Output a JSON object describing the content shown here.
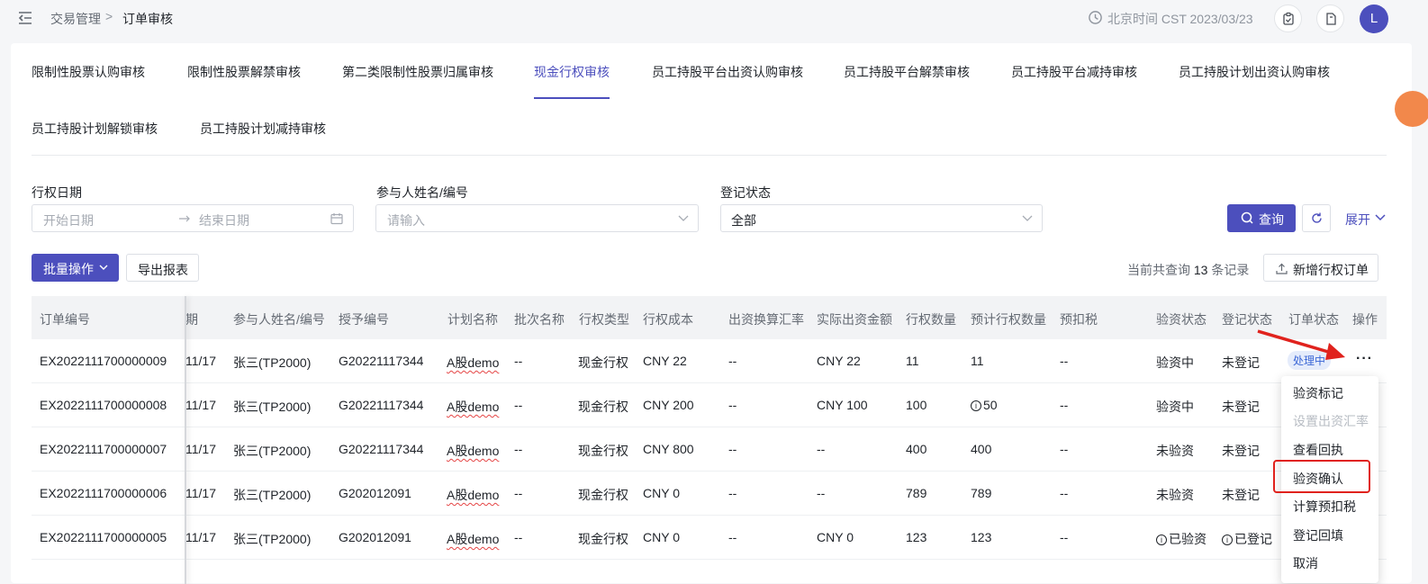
{
  "breadcrumb": {
    "parent": "交易管理",
    "separator": ">",
    "current": "订单审核"
  },
  "header": {
    "time_text": "北京时间 CST 2023/03/23",
    "avatar_letter": "L"
  },
  "tabs": [
    "限制性股票认购审核",
    "限制性股票解禁审核",
    "第二类限制性股票归属审核",
    "现金行权审核",
    "员工持股平台出资认购审核",
    "员工持股平台解禁审核",
    "员工持股平台减持审核",
    "员工持股计划出资认购审核",
    "员工持股计划解锁审核",
    "员工持股计划减持审核"
  ],
  "active_tab": "现金行权审核",
  "filters": {
    "date_label": "行权日期",
    "date_start_placeholder": "开始日期",
    "date_end_placeholder": "结束日期",
    "participant_label": "参与人姓名/编号",
    "participant_placeholder": "请输入",
    "register_label": "登记状态",
    "register_value": "全部",
    "query_button": "查询",
    "expand_link": "展开"
  },
  "toolbar": {
    "batch_button": "批量操作",
    "export_button": "导出报表",
    "count_prefix": "当前共查询",
    "count": "13",
    "count_suffix": "条记录",
    "add_button": "新增行权订单"
  },
  "table": {
    "columns": [
      "订单编号",
      "期",
      "参与人姓名/编号",
      "授予编号",
      "计划名称",
      "批次名称",
      "行权类型",
      "行权成本",
      "出资换算汇率",
      "实际出资金额",
      "行权数量",
      "预计行权数量",
      "预扣税",
      "验资状态",
      "登记状态",
      "订单状态",
      "操作"
    ],
    "rows": [
      {
        "order": "EX2022111700000009",
        "date": "11/17",
        "participant": "张三(TP2000)",
        "grant": "G20221117344",
        "plan": "A股demo",
        "batch": "--",
        "type": "现金行权",
        "cost": "CNY 22",
        "rate": "--",
        "amount": "CNY 22",
        "qty": "11",
        "est_qty": "11",
        "est_qty_info": false,
        "tax": "--",
        "verify": "验资中",
        "verify_info": false,
        "register": "未登记",
        "register_info": false,
        "order_status": "处理中",
        "action": "···"
      },
      {
        "order": "EX2022111700000008",
        "date": "11/17",
        "participant": "张三(TP2000)",
        "grant": "G20221117344",
        "plan": "A股demo",
        "batch": "--",
        "type": "现金行权",
        "cost": "CNY 200",
        "rate": "--",
        "amount": "CNY 100",
        "qty": "100",
        "est_qty": "50",
        "est_qty_info": true,
        "tax": "--",
        "verify": "验资中",
        "verify_info": false,
        "register": "未登记",
        "register_info": false,
        "order_status": "",
        "action": ""
      },
      {
        "order": "EX2022111700000007",
        "date": "11/17",
        "participant": "张三(TP2000)",
        "grant": "G20221117344",
        "plan": "A股demo",
        "batch": "--",
        "type": "现金行权",
        "cost": "CNY 800",
        "rate": "--",
        "amount": "--",
        "qty": "400",
        "est_qty": "400",
        "est_qty_info": false,
        "tax": "--",
        "verify": "未验资",
        "verify_info": false,
        "register": "未登记",
        "register_info": false,
        "order_status": "",
        "action": ""
      },
      {
        "order": "EX2022111700000006",
        "date": "11/17",
        "participant": "张三(TP2000)",
        "grant": "G202012091",
        "plan": "A股demo",
        "batch": "--",
        "type": "现金行权",
        "cost": "CNY 0",
        "rate": "--",
        "amount": "--",
        "qty": "789",
        "est_qty": "789",
        "est_qty_info": false,
        "tax": "--",
        "verify": "未验资",
        "verify_info": false,
        "register": "未登记",
        "register_info": false,
        "order_status": "",
        "action": ""
      },
      {
        "order": "EX2022111700000005",
        "date": "11/17",
        "participant": "张三(TP2000)",
        "grant": "G202012091",
        "plan": "A股demo",
        "batch": "--",
        "type": "现金行权",
        "cost": "CNY 0",
        "rate": "--",
        "amount": "CNY 0",
        "qty": "123",
        "est_qty": "123",
        "est_qty_info": false,
        "tax": "--",
        "verify": "已验资",
        "verify_info": true,
        "register": "已登记",
        "register_info": true,
        "order_status": "",
        "action": ""
      }
    ]
  },
  "action_menu": {
    "items": [
      {
        "label": "验资标记",
        "disabled": false
      },
      {
        "label": "设置出资汇率",
        "disabled": true
      },
      {
        "label": "查看回执",
        "disabled": false
      },
      {
        "label": "验资确认",
        "disabled": false
      },
      {
        "label": "计算预扣税",
        "disabled": false
      },
      {
        "label": "登记回填",
        "disabled": false
      },
      {
        "label": "取消",
        "disabled": false
      }
    ],
    "highlighted": "验资确认"
  },
  "colors": {
    "accent": "#4c4fbd",
    "annotation_red": "#e0221d",
    "badge_bg": "#e5ecfb",
    "badge_text": "#3a66d6"
  }
}
